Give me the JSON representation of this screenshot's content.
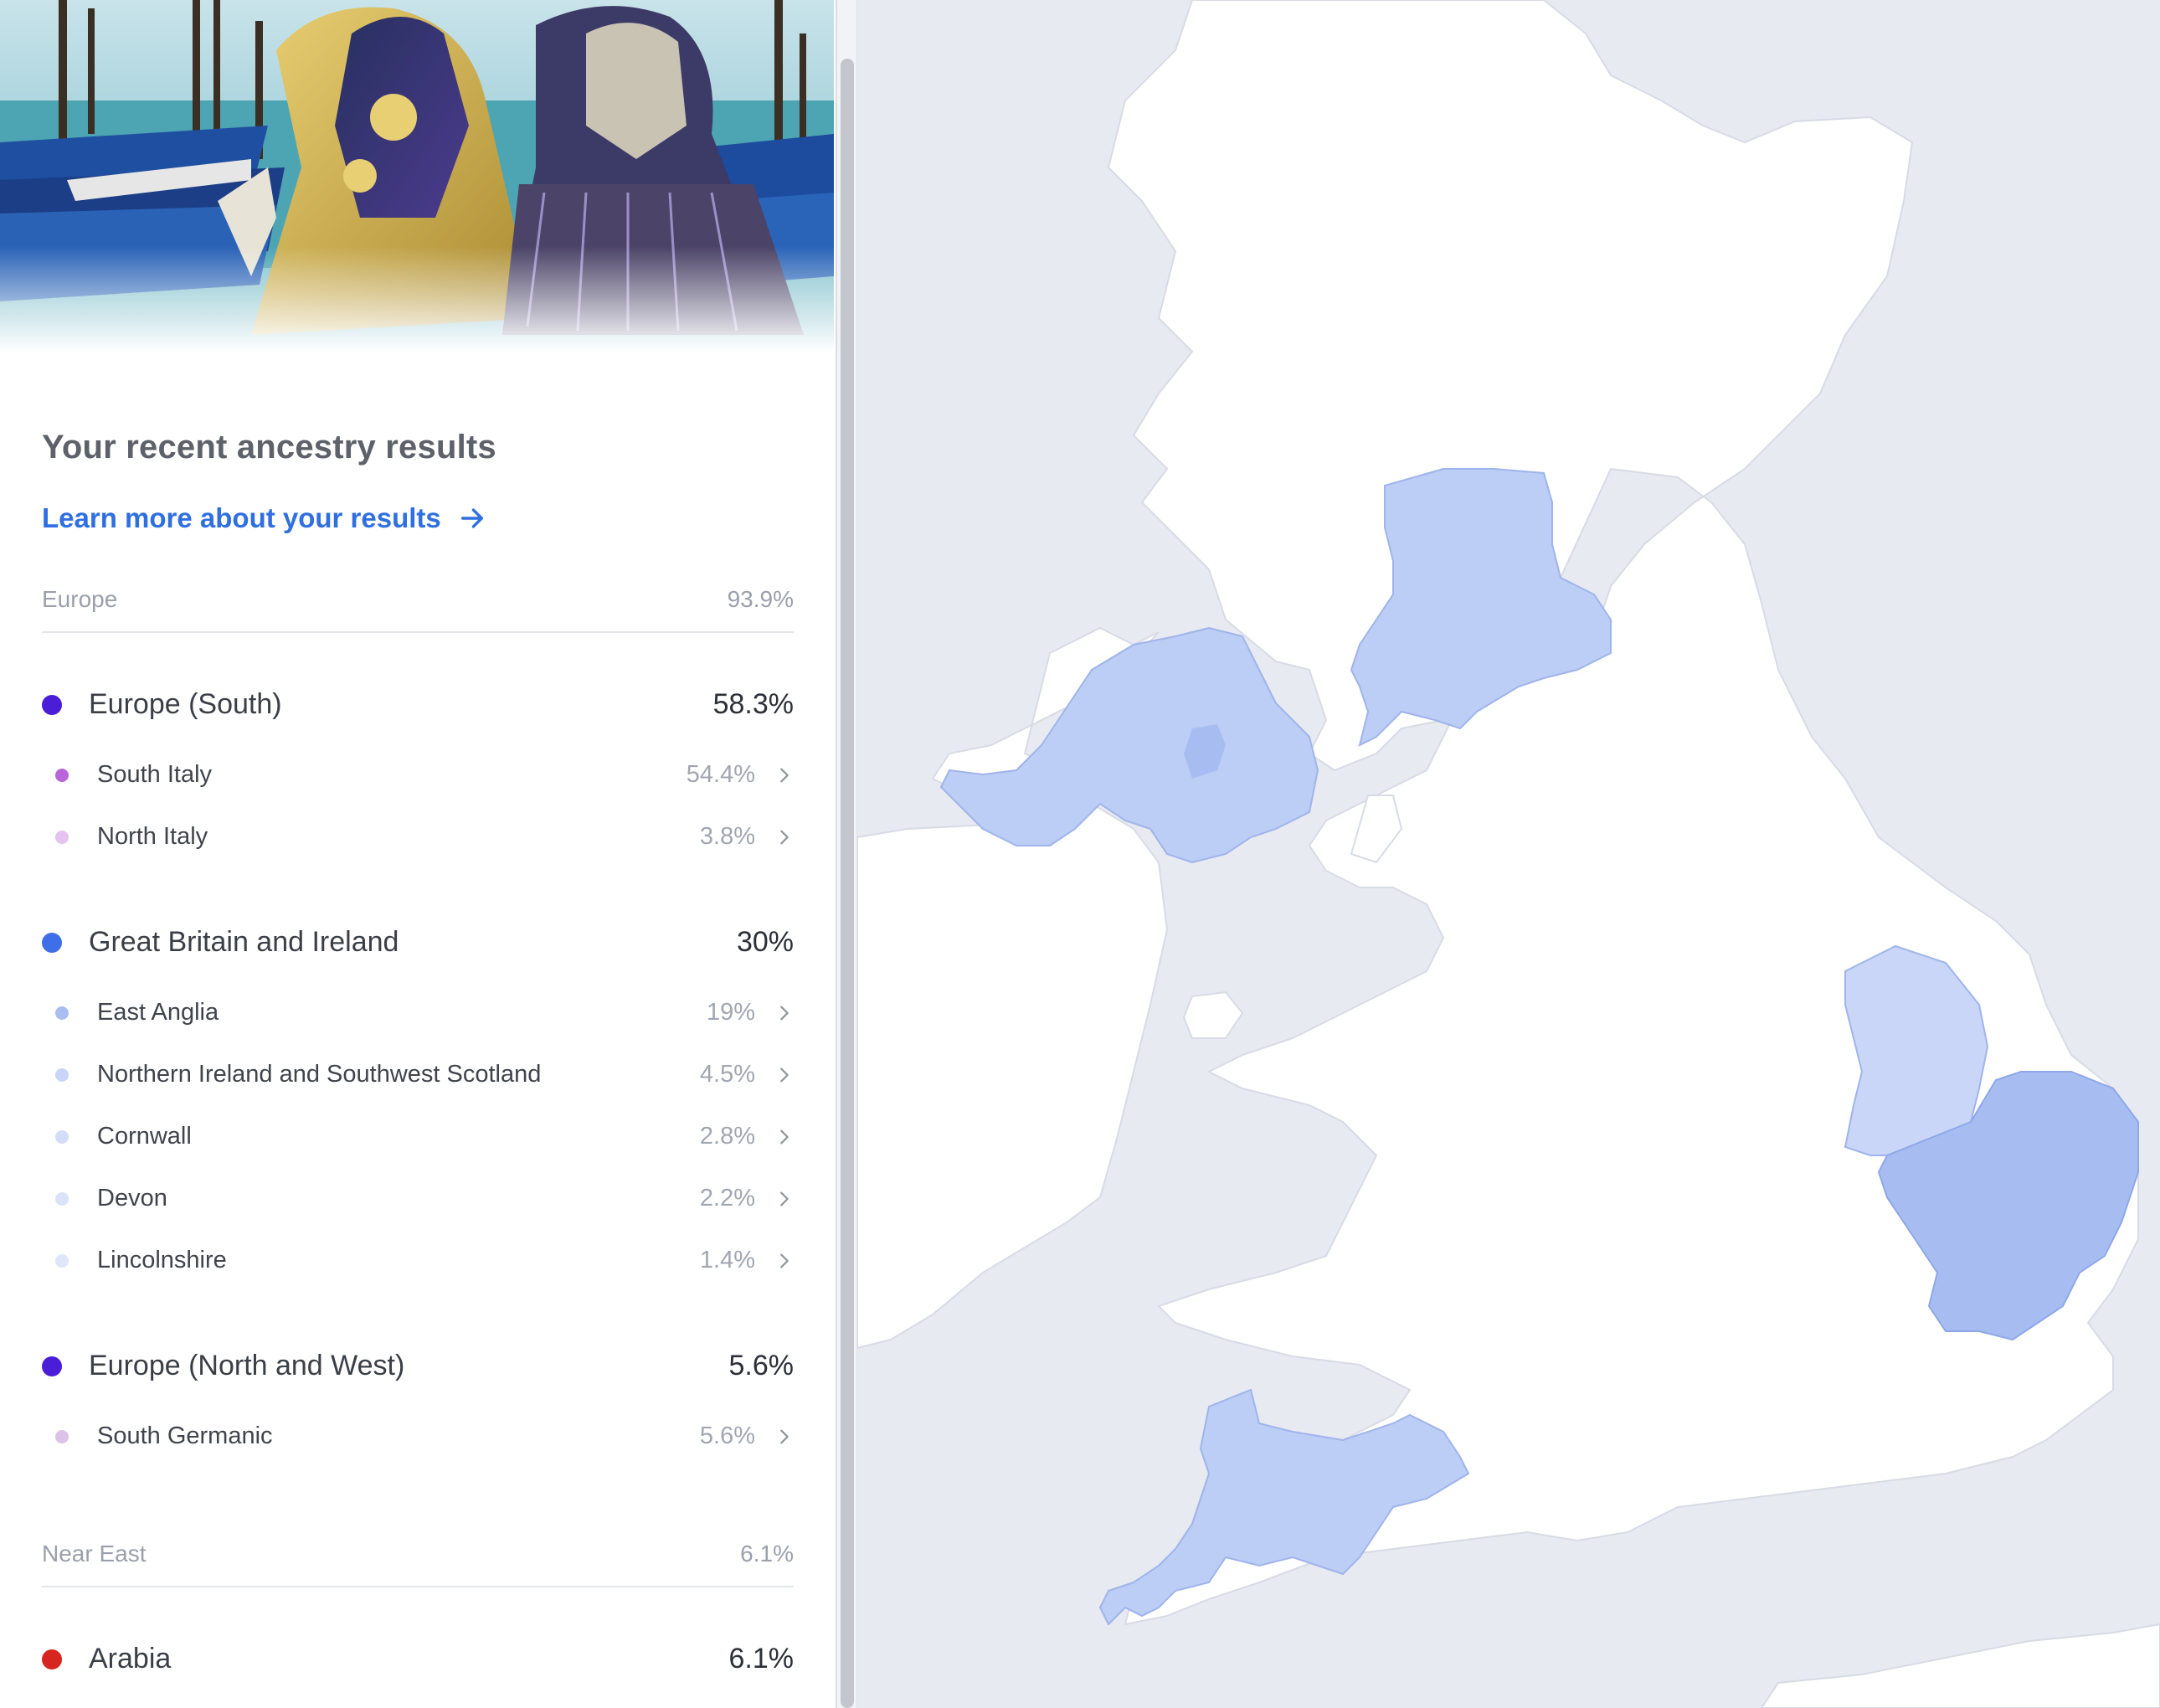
{
  "panel": {
    "title": "Your recent ancestry results",
    "learn_more": "Learn more about your results"
  },
  "sections": [
    {
      "name": "Europe",
      "percent": "93.9%",
      "groups": [
        {
          "name": "Europe (South)",
          "percent": "58.3%",
          "color": "#4a1ed8",
          "items": [
            {
              "name": "South Italy",
              "percent": "54.4%",
              "color": "#b765d9"
            },
            {
              "name": "North Italy",
              "percent": "3.8%",
              "color": "#e6c2ee"
            }
          ]
        },
        {
          "name": "Great Britain and Ireland",
          "percent": "30%",
          "color": "#3f6fe8",
          "items": [
            {
              "name": "East Anglia",
              "percent": "19%",
              "color": "#a9bdf1"
            },
            {
              "name": "Northern Ireland and Southwest Scotland",
              "percent": "4.5%",
              "color": "#c8d5f7"
            },
            {
              "name": "Cornwall",
              "percent": "2.8%",
              "color": "#d3ddf8"
            },
            {
              "name": "Devon",
              "percent": "2.2%",
              "color": "#dae2f9"
            },
            {
              "name": "Lincolnshire",
              "percent": "1.4%",
              "color": "#dfe6fa"
            }
          ]
        },
        {
          "name": "Europe (North and West)",
          "percent": "5.6%",
          "color": "#4a1ed8",
          "items": [
            {
              "name": "South Germanic",
              "percent": "5.6%",
              "color": "#dcc2e6"
            }
          ]
        }
      ]
    },
    {
      "name": "Near East",
      "percent": "6.1%",
      "groups": [
        {
          "name": "Arabia",
          "percent": "6.1%",
          "color": "#d6261f",
          "items": []
        }
      ]
    }
  ],
  "map": {
    "sea_color": "#e8eaf1",
    "land_color": "#ffffff",
    "highlight_colors": [
      "#bccdf6",
      "#a7bdf2",
      "#c9d6f8"
    ]
  },
  "icons": [
    "arrow-right-icon",
    "chevron-right-icon"
  ]
}
